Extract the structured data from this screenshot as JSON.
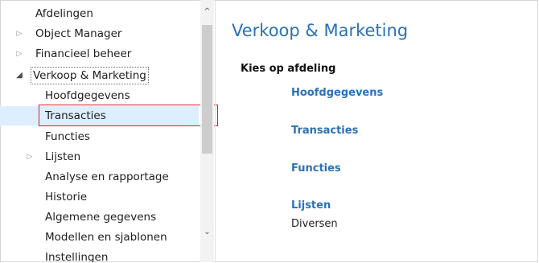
{
  "tree": {
    "items": [
      {
        "label": "Afdelingen",
        "arrow": ""
      },
      {
        "label": "Object Manager",
        "arrow": "▷"
      },
      {
        "label": "Financieel beheer",
        "arrow": "▷"
      },
      {
        "label": "Verkoop & Marketing",
        "arrow": "◢"
      },
      {
        "label": "Hoofdgegevens",
        "arrow": ""
      },
      {
        "label": "Transacties",
        "arrow": ""
      },
      {
        "label": "Functies",
        "arrow": ""
      },
      {
        "label": "Lijsten",
        "arrow": "▷"
      },
      {
        "label": "Analyse en rapportage",
        "arrow": ""
      },
      {
        "label": "Historie",
        "arrow": ""
      },
      {
        "label": "Algemene gegevens",
        "arrow": ""
      },
      {
        "label": "Modellen en sjablonen",
        "arrow": ""
      },
      {
        "label": "Instellingen",
        "arrow": ""
      }
    ],
    "selected": "Transacties"
  },
  "scrollbar": {
    "up_icon": "chevron-up-icon",
    "down_icon": "chevron-down-icon",
    "up_glyph": "^",
    "down_glyph": "⌄"
  },
  "main": {
    "title": "Verkoop & Marketing",
    "section_label": "Kies op afdeling",
    "links": [
      {
        "label": "Hoofdgegevens"
      },
      {
        "label": "Transacties"
      },
      {
        "label": "Functies"
      },
      {
        "label": "Lijsten"
      }
    ],
    "extra": "Diversen"
  },
  "colors": {
    "accent": "#2a72b5",
    "selection": "#ddeeff",
    "highlight_box": "#d9202a"
  }
}
